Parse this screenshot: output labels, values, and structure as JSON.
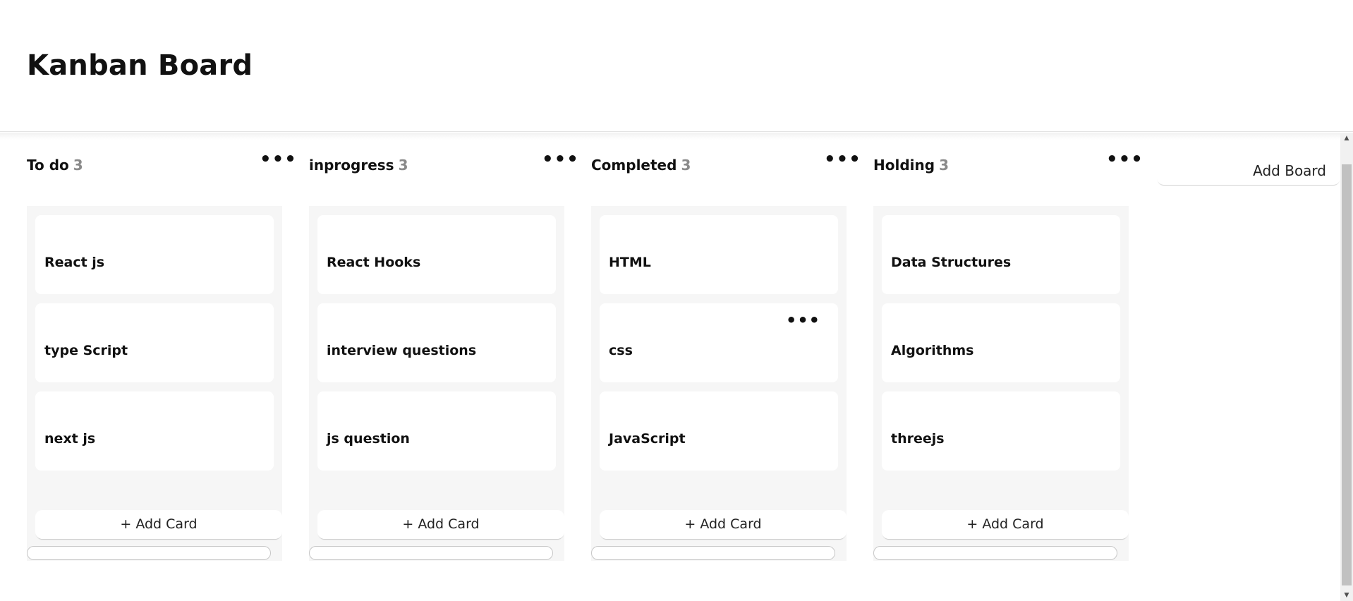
{
  "header": {
    "title": "Kanban Board"
  },
  "boards": [
    {
      "title": "To do",
      "count": "3",
      "more_icon": "more-horizontal-icon",
      "cards": [
        {
          "title": "React js"
        },
        {
          "title": "type Script"
        },
        {
          "title": "next js"
        }
      ],
      "add_card_label": "+ Add Card"
    },
    {
      "title": "inprogress",
      "count": "3",
      "more_icon": "more-horizontal-icon",
      "cards": [
        {
          "title": "React Hooks"
        },
        {
          "title": "interview questions"
        },
        {
          "title": "js question"
        }
      ],
      "add_card_label": "+ Add Card"
    },
    {
      "title": "Completed",
      "count": "3",
      "more_icon": "more-horizontal-icon",
      "cards": [
        {
          "title": "HTML"
        },
        {
          "title": "css"
        },
        {
          "title": "JavaScript"
        }
      ],
      "add_card_label": "+ Add Card"
    },
    {
      "title": "Holding",
      "count": "3",
      "more_icon": "more-horizontal-icon",
      "cards": [
        {
          "title": "Data Structures"
        },
        {
          "title": "Algorithms"
        },
        {
          "title": "threejs"
        }
      ],
      "add_card_label": "+ Add Card"
    }
  ],
  "add_board": {
    "label": "Add Board"
  },
  "icons": {
    "more": "•••",
    "scroll_up": "▲",
    "scroll_down": "▼"
  },
  "colors": {
    "board_background": "#f6f6f6",
    "card_background": "#ffffff",
    "count_color": "#8a8a8a"
  }
}
